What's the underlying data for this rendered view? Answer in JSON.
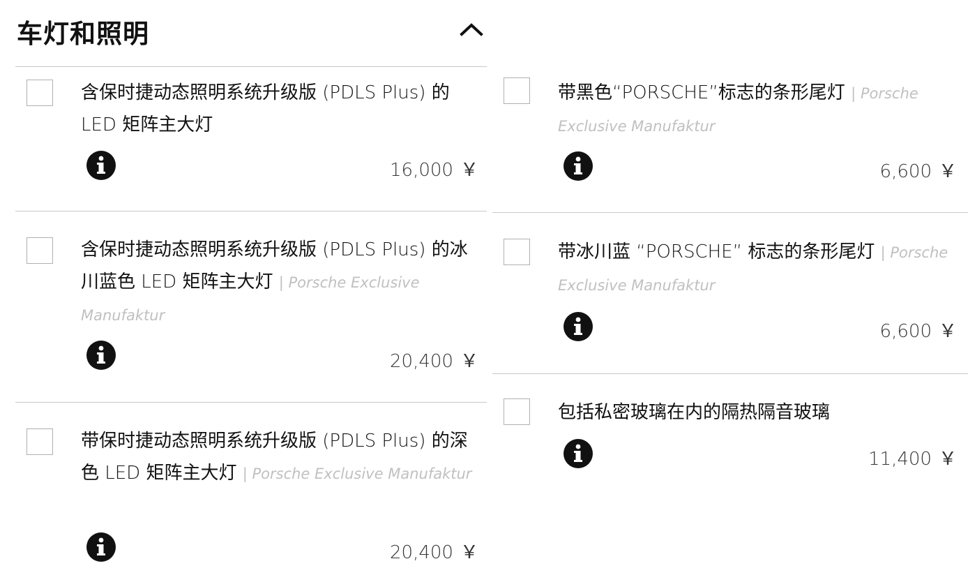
{
  "section": {
    "title": "车灯和照明",
    "expanded": true
  },
  "options": [
    {
      "id": "pdls-plus-led-matrix",
      "label": "含保时捷动态照明系统升级版 (PDLS Plus) 的 LED 矩阵主大灯",
      "vendor": "",
      "price": "16,000",
      "currency": "￥",
      "checked": false
    },
    {
      "id": "pdls-plus-glacier-blue",
      "label": "含保时捷动态照明系统升级版 (PDLS Plus) 的冰川蓝色 LED 矩阵主大灯",
      "vendor": "| Porsche Exclusive Manufaktur",
      "price": "20,400",
      "currency": "￥",
      "checked": false
    },
    {
      "id": "pdls-plus-dark",
      "label": "带保时捷动态照明系统升级版 (PDLS Plus) 的深色 LED 矩阵主大灯",
      "vendor": "| Porsche Exclusive Manufaktur",
      "price": "20,400",
      "currency": "￥",
      "checked": false
    },
    {
      "id": "taillight-black-logo",
      "label": "带黑色“PORSCHE”标志的条形尾灯",
      "vendor": "| Porsche Exclusive Manufaktur",
      "price": "6,600",
      "currency": "￥",
      "checked": false
    },
    {
      "id": "taillight-glacier-blue-logo",
      "label": "带冰川蓝 “PORSCHE” 标志的条形尾灯",
      "vendor": "| Porsche Exclusive Manufaktur",
      "price": "6,600",
      "currency": "￥",
      "checked": false
    },
    {
      "id": "privacy-insulated-glass",
      "label": "包括私密玻璃在内的隔热隔音玻璃",
      "vendor": "",
      "price": "11,400",
      "currency": "￥",
      "checked": false
    }
  ],
  "icons": {
    "collapse": "chevron-up-icon",
    "info": "info-icon"
  },
  "colors": {
    "text": "#111111",
    "vendor": "#c0c0c0",
    "divider": "#c8c8c8",
    "checkbox_border": "#b0b0b0"
  }
}
